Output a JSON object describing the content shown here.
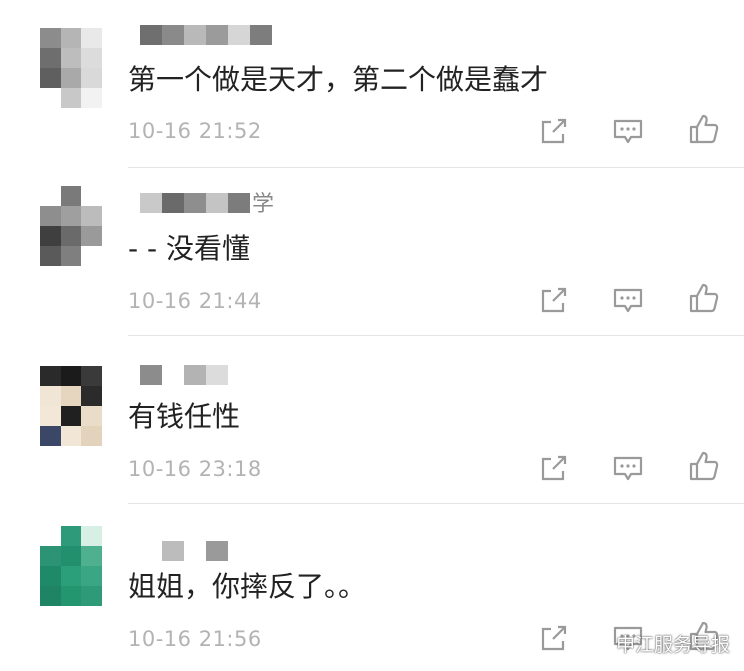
{
  "comments": [
    {
      "username_tail": "",
      "text": "第一个做是天才，第二个做是蠢才",
      "time": "10-16 21:52",
      "avatar": [
        "#8c8c8c",
        "#b5b5b5",
        "#e9e9e9",
        "#6e6e6e",
        "#bdbdbd",
        "#dcdcdc",
        "#5f5f5f",
        "#a9a9a9",
        "#d9d9d9",
        "#ffffff",
        "#c8c8c8",
        "#f2f2f2"
      ],
      "username_blocks": [
        "#6f6f6f",
        "#8a8a8a",
        "#b9b9b9",
        "#9b9b9b",
        "#d6d6d6",
        "#7d7d7d"
      ]
    },
    {
      "username_tail": "学",
      "text": "- - 没看懂",
      "time": "10-16 21:44",
      "avatar": [
        "#ffffff",
        "#7a7a7a",
        "#ffffff",
        "#8e8e8e",
        "#9f9f9f",
        "#bcbcbc",
        "#3f3f3f",
        "#6a6a6a",
        "#9a9a9a",
        "#5a5a5a",
        "#7f7f7f",
        "#ffffff"
      ],
      "username_blocks": [
        "#c9c9c9",
        "#6a6a6a",
        "#8e8e8e",
        "#c4c4c4",
        "#7c7c7c"
      ]
    },
    {
      "username_tail": "",
      "text": "有钱任性",
      "time": "10-16 23:18",
      "avatar": [
        "#2a2a2a",
        "#1b1b1b",
        "#3a3a3a",
        "#f1e6d6",
        "#e6d5bf",
        "#2b2b2b",
        "#f3e8d8",
        "#202020",
        "#e9dcc9",
        "#3b4766",
        "#f2e7d6",
        "#e3d3bd"
      ],
      "username_blocks": [
        "#8c8c8c",
        "#ffffff",
        "#b3b3b3",
        "#dcdcdc"
      ]
    },
    {
      "username_tail": "",
      "text": "姐姐，你摔反了。。",
      "time": "10-16 21:56",
      "avatar": [
        "#ffffff",
        "#2f9a79",
        "#d8efe6",
        "#2c9474",
        "#23906d",
        "#4fb08f",
        "#1f8a67",
        "#2a9f7a",
        "#3aa684",
        "#1e8463",
        "#24966f",
        "#2e9a77"
      ],
      "username_blocks": [
        "#ffffff",
        "#bcbcbc",
        "#ffffff",
        "#9a9a9a"
      ]
    }
  ],
  "actions": {
    "share_icon": "share-icon",
    "reply_icon": "reply-icon",
    "like_icon": "like-icon"
  },
  "watermark": {
    "text": "申江服务导报"
  },
  "colors": {
    "text": "#222222",
    "time": "#b3b3b3",
    "icon": "#9a9a9a",
    "divider": "#e6e6e6"
  }
}
